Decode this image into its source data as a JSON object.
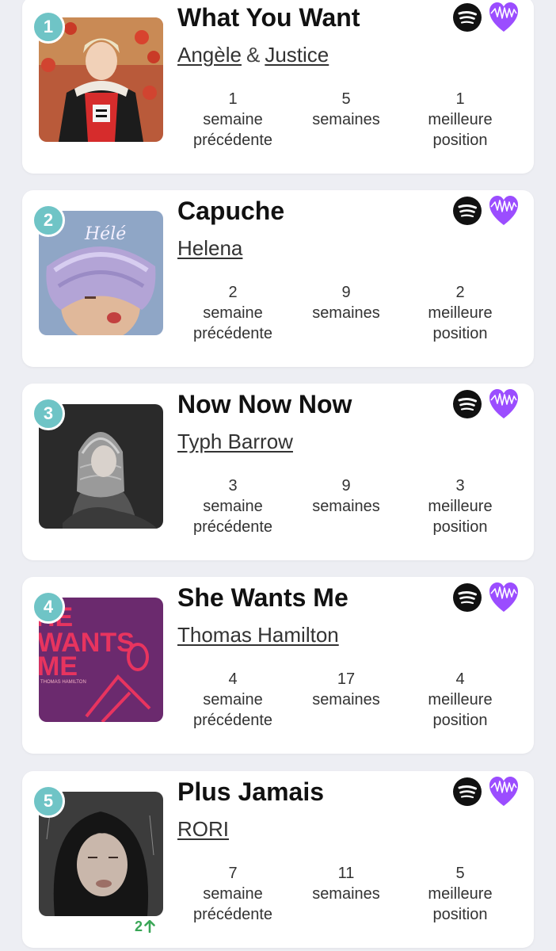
{
  "accent_colors": {
    "rank_badge": "#6fc4c6",
    "heart": "#9b4dff",
    "spotify": "#111111",
    "change_up": "#3aa657"
  },
  "labels": {
    "prev_line1": "semaine",
    "prev_line2": "précédente",
    "weeks_label": "semaines",
    "best_line1": "meilleure",
    "best_line2": "position",
    "ampersand": "&"
  },
  "icons": {
    "streaming": "spotify-icon",
    "like": "heart-icon",
    "trend": "arrow-up-icon"
  },
  "tracks": [
    {
      "rank": "1",
      "title": "What You Want",
      "artists": [
        "Angèle",
        "Justice"
      ],
      "previous_week": "1",
      "weeks": "5",
      "best_position": "1",
      "change": ""
    },
    {
      "rank": "2",
      "title": "Capuche",
      "artists": [
        "Helena"
      ],
      "previous_week": "2",
      "weeks": "9",
      "best_position": "2",
      "change": ""
    },
    {
      "rank": "3",
      "title": "Now Now Now",
      "artists": [
        "Typh Barrow"
      ],
      "previous_week": "3",
      "weeks": "9",
      "best_position": "3",
      "change": ""
    },
    {
      "rank": "4",
      "title": "She Wants Me",
      "artists": [
        "Thomas Hamilton"
      ],
      "previous_week": "4",
      "weeks": "17",
      "best_position": "4",
      "change": ""
    },
    {
      "rank": "5",
      "title": "Plus Jamais",
      "artists": [
        "RORI"
      ],
      "previous_week": "7",
      "weeks": "11",
      "best_position": "5",
      "change": "2"
    }
  ],
  "cover_texts": {
    "cover_2_script": "Hélé",
    "cover_4_line1": "HE",
    "cover_4_line2": "WANTS",
    "cover_4_line3": "ME",
    "cover_4_small": "THOMAS HAMILTON"
  }
}
